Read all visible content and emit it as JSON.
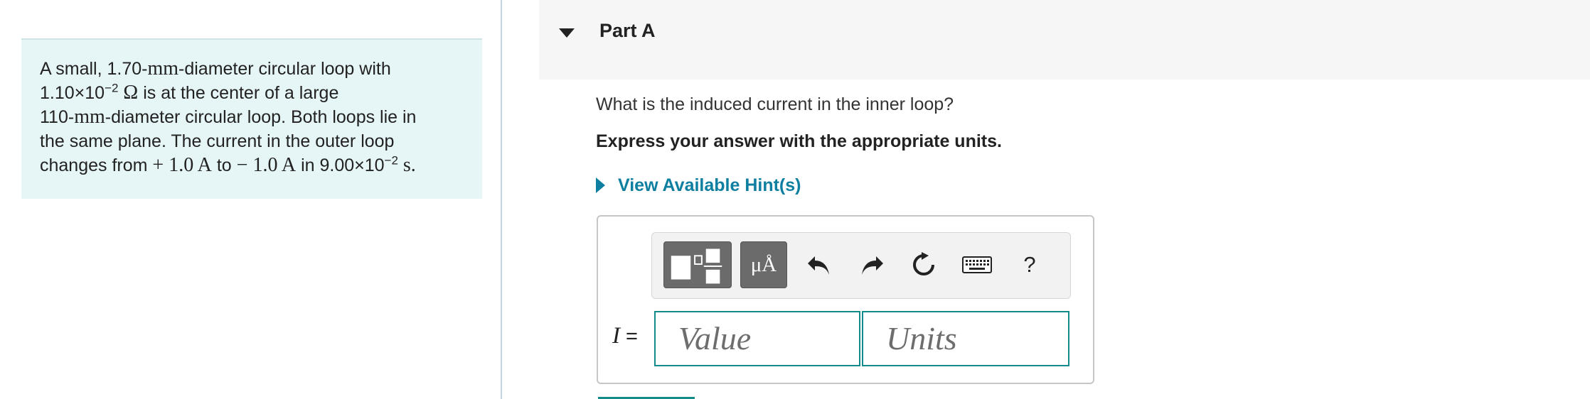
{
  "problem": {
    "segments": {
      "s1": "A small, 1.70-",
      "m1": "mm",
      "s2": "-diameter circular loop with",
      "s3": "1.10×10",
      "e1": "−2",
      "m2": "Ω",
      "s4": "is at the center of a large",
      "s5": "110-",
      "m3": "mm",
      "s6": "-diameter circular loop. Both loops lie in",
      "s7": "the same plane. The current in the outer loop",
      "s8": "changes from",
      "m4": "+ 1.0 A",
      "s9": "to",
      "m5": "− 1.0 A",
      "s10": "in 9.00×10",
      "e2": "−2",
      "m6": "s",
      "s11": "."
    }
  },
  "part": {
    "title": "Part A",
    "question": "What is the induced current in the inner loop?",
    "instruction": "Express your answer with the appropriate units.",
    "hint_label": "View Available Hint(s)"
  },
  "toolbar": {
    "units_label": "μÅ",
    "help_label": "?",
    "icons": [
      "templates-icon",
      "units-icon",
      "undo-icon",
      "redo-icon",
      "reset-icon",
      "keyboard-icon",
      "help-icon"
    ]
  },
  "answer": {
    "variable": "I",
    "equals": " =",
    "value_placeholder": "Value",
    "units_placeholder": "Units"
  },
  "colors": {
    "accent": "#0e7fa0",
    "field_border": "#148b8b",
    "problem_bg": "#e6f5f5"
  }
}
